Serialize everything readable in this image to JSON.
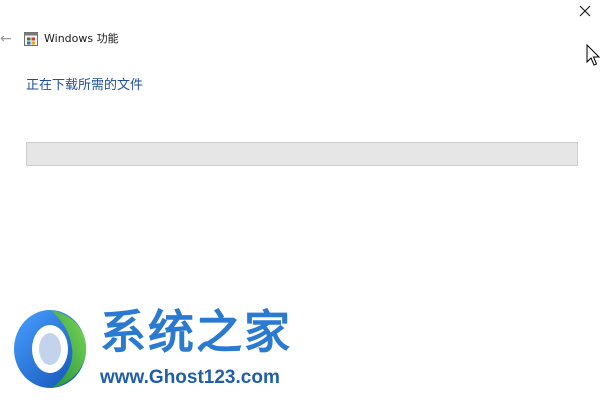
{
  "window": {
    "title": "Windows 功能",
    "back_icon": "back-arrow-icon",
    "app_icon": "windows-features-icon",
    "close_icon": "close-icon",
    "close_glyph": "✕",
    "back_glyph": "←"
  },
  "content": {
    "status_text": "正在下载所需的文件",
    "progress": 0
  },
  "watermark": {
    "title": "系统之家",
    "url": "www.Ghost123.com"
  },
  "colors": {
    "status_text": "#1d4f9a",
    "progress_track": "#e6e6e6",
    "watermark_blue": "#2a7ad2",
    "watermark_green": "#3fae49"
  }
}
